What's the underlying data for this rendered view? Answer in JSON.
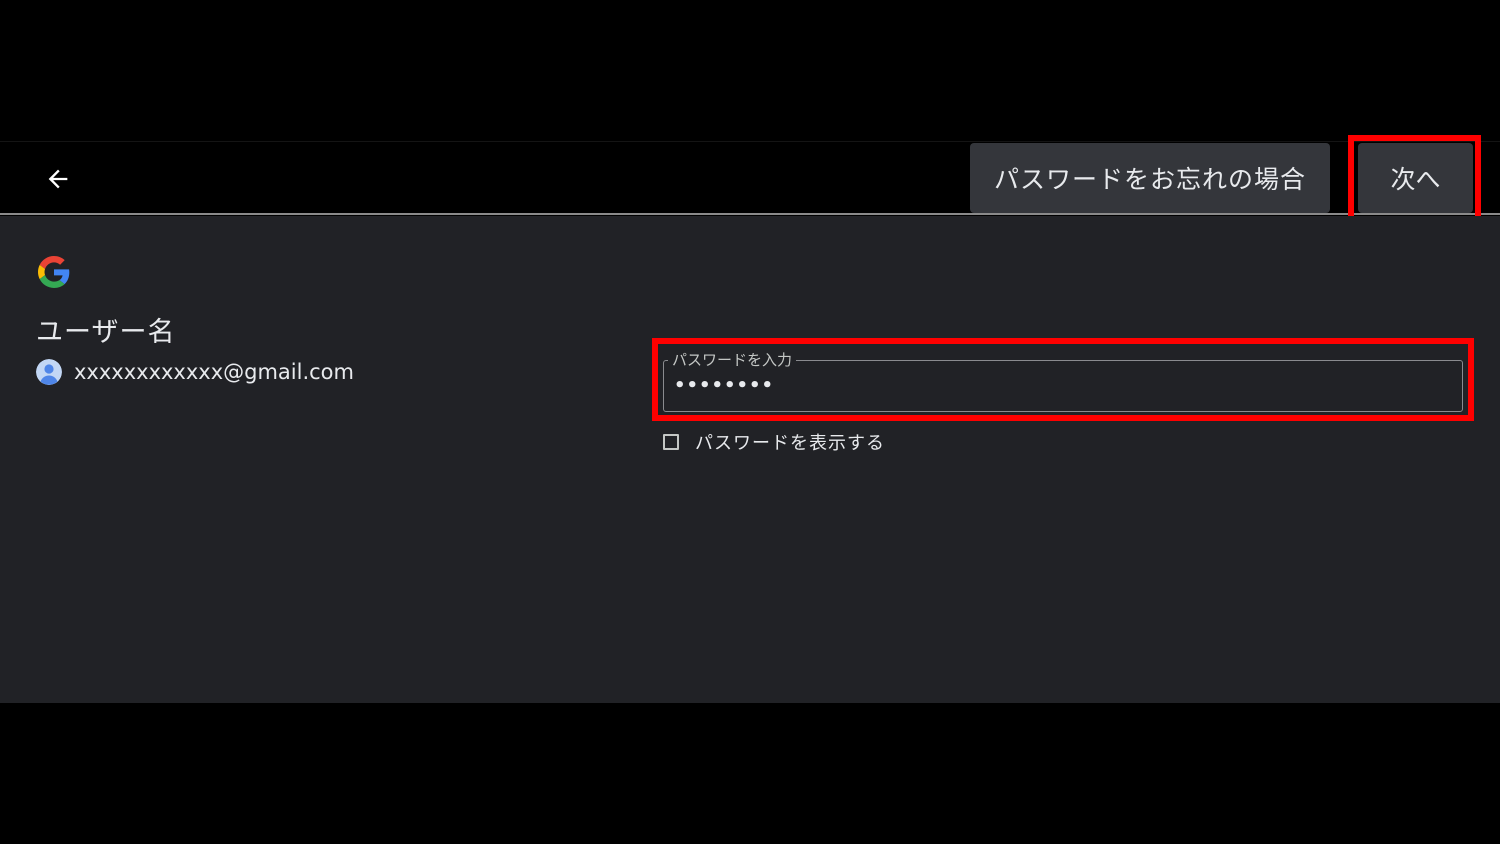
{
  "header": {
    "back_icon": "arrow-left-icon",
    "forgot_label": "パスワードをお忘れの場合",
    "next_label": "次へ"
  },
  "account": {
    "logo_icon": "google-g-icon",
    "title": "ユーザー名",
    "avatar_icon": "avatar-person-icon",
    "email": "xxxxxxxxxxxx@gmail.com"
  },
  "password": {
    "label": "パスワードを入力",
    "value": "••••••••",
    "show_label": "パスワードを表示する",
    "show_checked": false
  },
  "colors": {
    "background": "#000000",
    "panel": "#212226",
    "button": "#34363b",
    "text": "#e8eaed",
    "highlight": "#ff0000"
  }
}
